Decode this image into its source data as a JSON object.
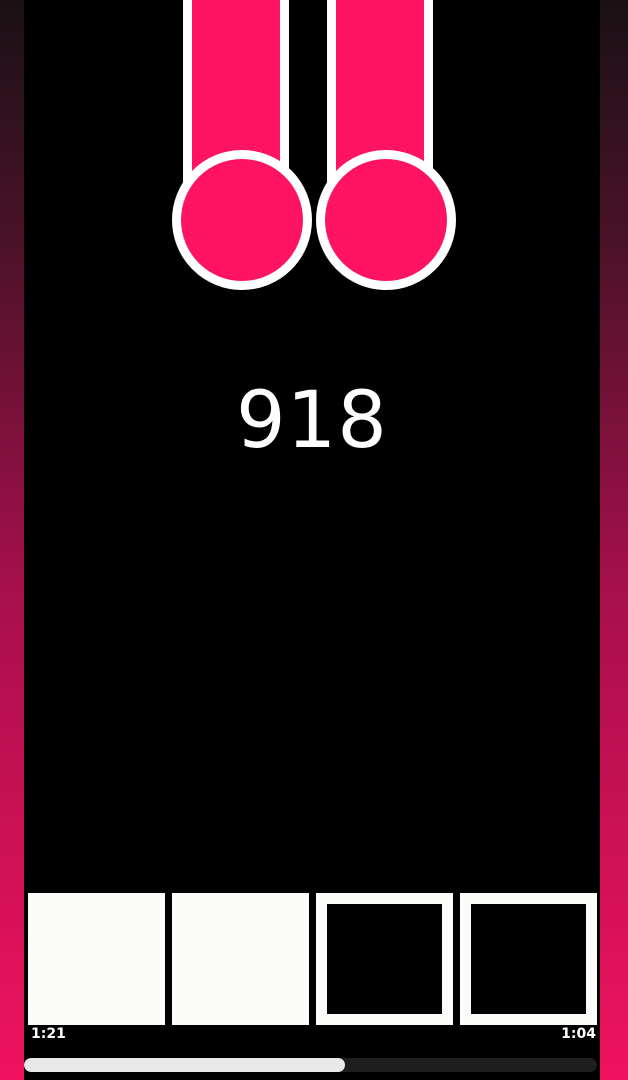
{
  "score": "918",
  "time_elapsed": "1:21",
  "time_remaining": "1:04",
  "progress_fraction": 0.56,
  "notes": [
    {
      "lane": "lane-2",
      "type": "hold"
    },
    {
      "lane": "lane-3",
      "type": "hold"
    }
  ],
  "pads": [
    {
      "id": "pad-1",
      "state": "filled"
    },
    {
      "id": "pad-2",
      "state": "filled"
    },
    {
      "id": "pad-3",
      "state": "hollow"
    },
    {
      "id": "pad-4",
      "state": "hollow"
    }
  ],
  "colors": {
    "note": "#ff1463",
    "note_outline": "#ffffff",
    "accent": "#f0125f",
    "background": "#000000"
  }
}
